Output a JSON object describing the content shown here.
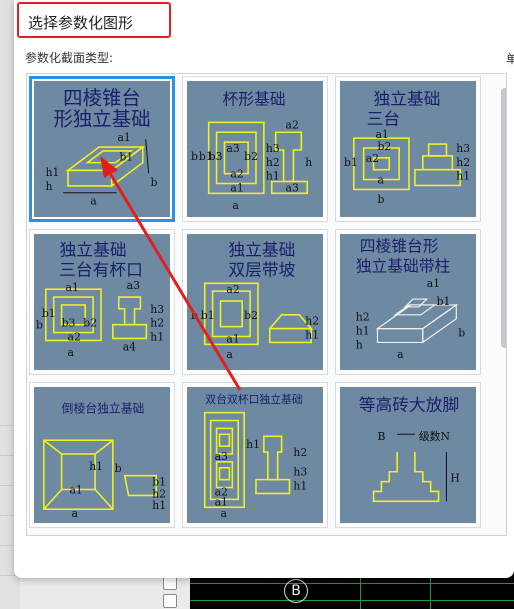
{
  "dialog": {
    "title": "选择参数化图形",
    "section_label": "参数化截面类型:",
    "right_edge_text": "单"
  },
  "shapes": [
    {
      "caption_line1": "四棱锥台",
      "caption_line2": "形独立基础",
      "labels": [
        "a1",
        "b1",
        "h1",
        "h",
        "a",
        "b"
      ]
    },
    {
      "caption_line1": "杯形基础",
      "caption_line2": "",
      "labels": [
        "b",
        "b1",
        "b3",
        "a3",
        "b2",
        "a2",
        "a1",
        "h3",
        "h2",
        "h1",
        "a2",
        "h",
        "a3",
        "a"
      ]
    },
    {
      "caption_line1": "独立基础",
      "caption_line2": "三台",
      "labels": [
        "a1",
        "b2",
        "a2",
        "b1",
        "a",
        "h3",
        "h2",
        "h1",
        "b"
      ]
    },
    {
      "caption_line1": "独立基础",
      "caption_line2": "三台有杯口",
      "labels": [
        "a3",
        "a1",
        "b",
        "b1",
        "b3",
        "b2",
        "a2",
        "a",
        "h3",
        "h2",
        "h1",
        "a4"
      ]
    },
    {
      "caption_line1": "独立基础",
      "caption_line2": "双层带坡",
      "labels": [
        "a2",
        "b1",
        "b",
        "b2",
        "a1",
        "a",
        "h2",
        "h1"
      ]
    },
    {
      "caption_line1": "四棱锥台形",
      "caption_line2": "独立基础带柱",
      "labels": [
        "a1",
        "b1",
        "h2",
        "h1",
        "h",
        "a",
        "b"
      ]
    },
    {
      "caption_line1": "倒棱台独立基础",
      "caption_line2": "",
      "labels": [
        "h1",
        "b",
        "a1",
        "a",
        "b1",
        "h2",
        "h1"
      ]
    },
    {
      "caption_line1": "双台双杯口独立基础",
      "caption_line2": "",
      "labels": [
        "a3",
        "a2",
        "a1",
        "a",
        "h1",
        "h2",
        "h3",
        "h1"
      ]
    },
    {
      "caption_line1": "等高砖大放脚",
      "caption_line2": "",
      "labels": [
        "B",
        "级数N",
        "H"
      ]
    }
  ],
  "background": {
    "axis_label": "B"
  },
  "colors": {
    "selection_border": "#2f8fe6",
    "annotation_red": "#e02020",
    "tile_bg": "#6e8aa3",
    "drawing_yellow": "#f0f020"
  }
}
